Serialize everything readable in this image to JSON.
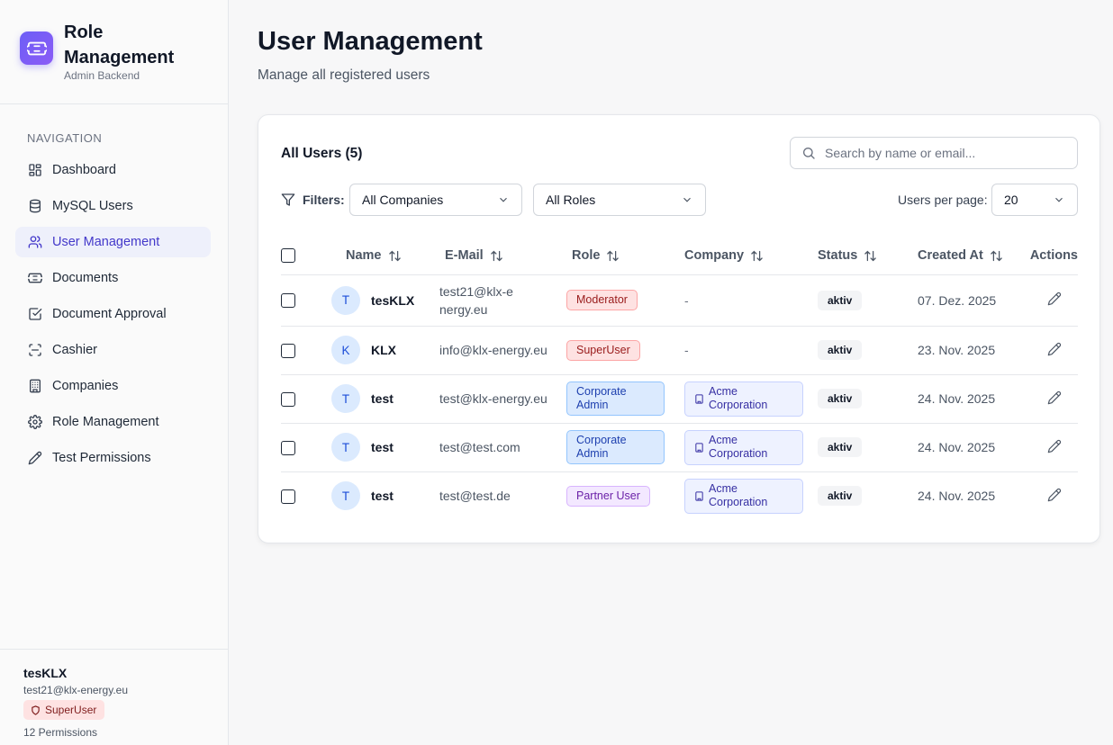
{
  "brand": {
    "title": "Role Management",
    "subtitle": "Admin Backend",
    "icon": "ticket-icon",
    "accent": "#7c5cf6"
  },
  "sidebar": {
    "heading": "NAVIGATION",
    "items": [
      {
        "label": "Dashboard",
        "icon": "dashboard-icon",
        "active": false
      },
      {
        "label": "MySQL Users",
        "icon": "database-icon",
        "active": false
      },
      {
        "label": "User Management",
        "icon": "users-icon",
        "active": true
      },
      {
        "label": "Documents",
        "icon": "ticket-icon",
        "active": false
      },
      {
        "label": "Document Approval",
        "icon": "check-square-icon",
        "active": false
      },
      {
        "label": "Cashier",
        "icon": "scan-icon",
        "active": false
      },
      {
        "label": "Companies",
        "icon": "building-icon",
        "active": false
      },
      {
        "label": "Role Management",
        "icon": "gear-icon",
        "active": false
      },
      {
        "label": "Test Permissions",
        "icon": "pencil-icon",
        "active": false
      }
    ],
    "footer": {
      "user_name": "tesKLX",
      "user_email": "test21@klx-energy.eu",
      "role": "SuperUser",
      "permissions": "12 Permissions"
    }
  },
  "page": {
    "title": "User Management",
    "subtitle": "Manage all registered users"
  },
  "card": {
    "title": "All Users (5)",
    "search_placeholder": "Search by name or email...",
    "filters_label": "Filters:",
    "company_filter": "All Companies",
    "role_filter": "All Roles",
    "per_page_label": "Users per page:",
    "per_page_value": "20"
  },
  "table": {
    "columns": {
      "name": "Name",
      "email": "E-Mail",
      "role": "Role",
      "company": "Company",
      "status": "Status",
      "created": "Created At",
      "actions": "Actions"
    },
    "rows": [
      {
        "initial": "T",
        "name": "tesKLX",
        "email": "test21@klx-energy.eu",
        "role": "Moderator",
        "company": "-",
        "status": "aktiv",
        "created": "07. Dez. 2025"
      },
      {
        "initial": "K",
        "name": "KLX",
        "email": "info@klx-energy.eu",
        "role": "SuperUser",
        "company": "-",
        "status": "aktiv",
        "created": "23. Nov. 2025"
      },
      {
        "initial": "T",
        "name": "test",
        "email": "test@klx-energy.eu",
        "role": "Corporate Admin",
        "company": "Acme Corporation",
        "status": "aktiv",
        "created": "24. Nov. 2025"
      },
      {
        "initial": "T",
        "name": "test",
        "email": "test@test.com",
        "role": "Corporate Admin",
        "company": "Acme Corporation",
        "status": "aktiv",
        "created": "24. Nov. 2025"
      },
      {
        "initial": "T",
        "name": "test",
        "email": "test@test.de",
        "role": "Partner User",
        "company": "Acme Corporation",
        "status": "aktiv",
        "created": "24. Nov. 2025"
      }
    ]
  }
}
